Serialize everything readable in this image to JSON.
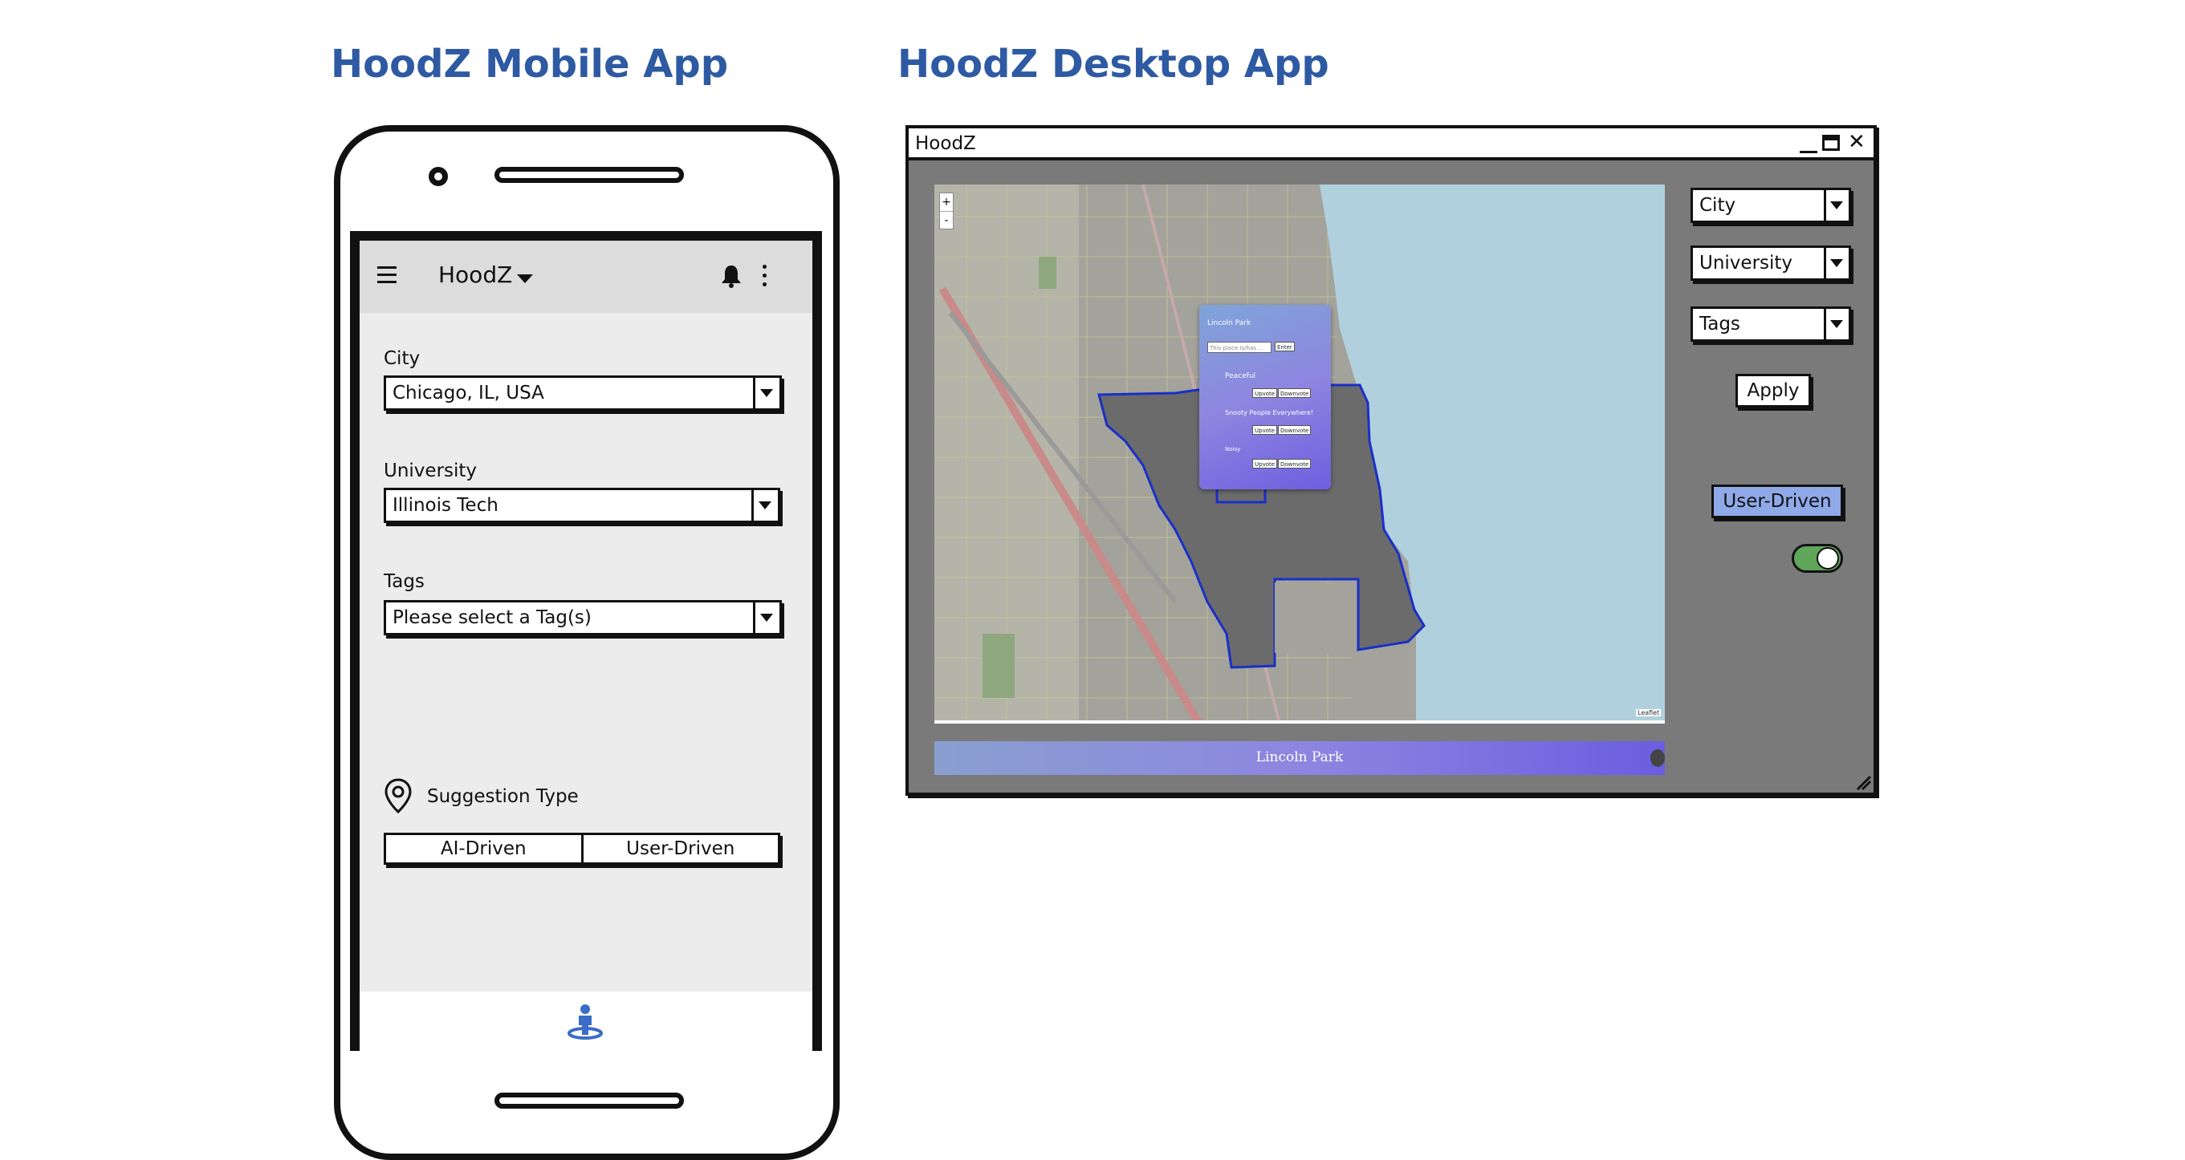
{
  "mobile": {
    "heading": "HoodZ Mobile App",
    "appbar": {
      "title": "HoodZ"
    },
    "fields": {
      "city": {
        "label": "City",
        "value": "Chicago, IL, USA"
      },
      "university": {
        "label": "University",
        "value": "Illinois Tech"
      },
      "tags": {
        "label": "Tags",
        "value": "Please select a Tag(s)"
      }
    },
    "suggestion": {
      "label": "Suggestion Type",
      "options": [
        "AI-Driven",
        "User-Driven"
      ]
    }
  },
  "desktop": {
    "heading": "HoodZ Desktop App",
    "window_title": "HoodZ",
    "filters": {
      "city": "City",
      "university": "University",
      "tags": "Tags",
      "apply": "Apply"
    },
    "mode_label": "User-Driven",
    "toggle_on": true,
    "map": {
      "zoom_in": "+",
      "zoom_out": "-",
      "attribution": "Leaflet",
      "popup": {
        "title": "Lincoln Park",
        "input_placeholder": "This place is/has ...",
        "enter": "Enter",
        "tags": [
          {
            "name": "Peaceful",
            "up": "Upvote",
            "down": "Downvote"
          },
          {
            "name": "Snooty People Everywhere!",
            "up": "Upvote",
            "down": "Downvote"
          },
          {
            "name": "Noisy",
            "up": "Upvote",
            "down": "Downvote"
          }
        ]
      },
      "footer_title": "Lincoln Park"
    }
  },
  "colors": {
    "heading": "#2e5aa3",
    "accent_blue": "#8fa9e8",
    "toggle_green": "#5fa55a",
    "lake": "#b1d0de",
    "neighborhood": "#6b6b6b"
  }
}
